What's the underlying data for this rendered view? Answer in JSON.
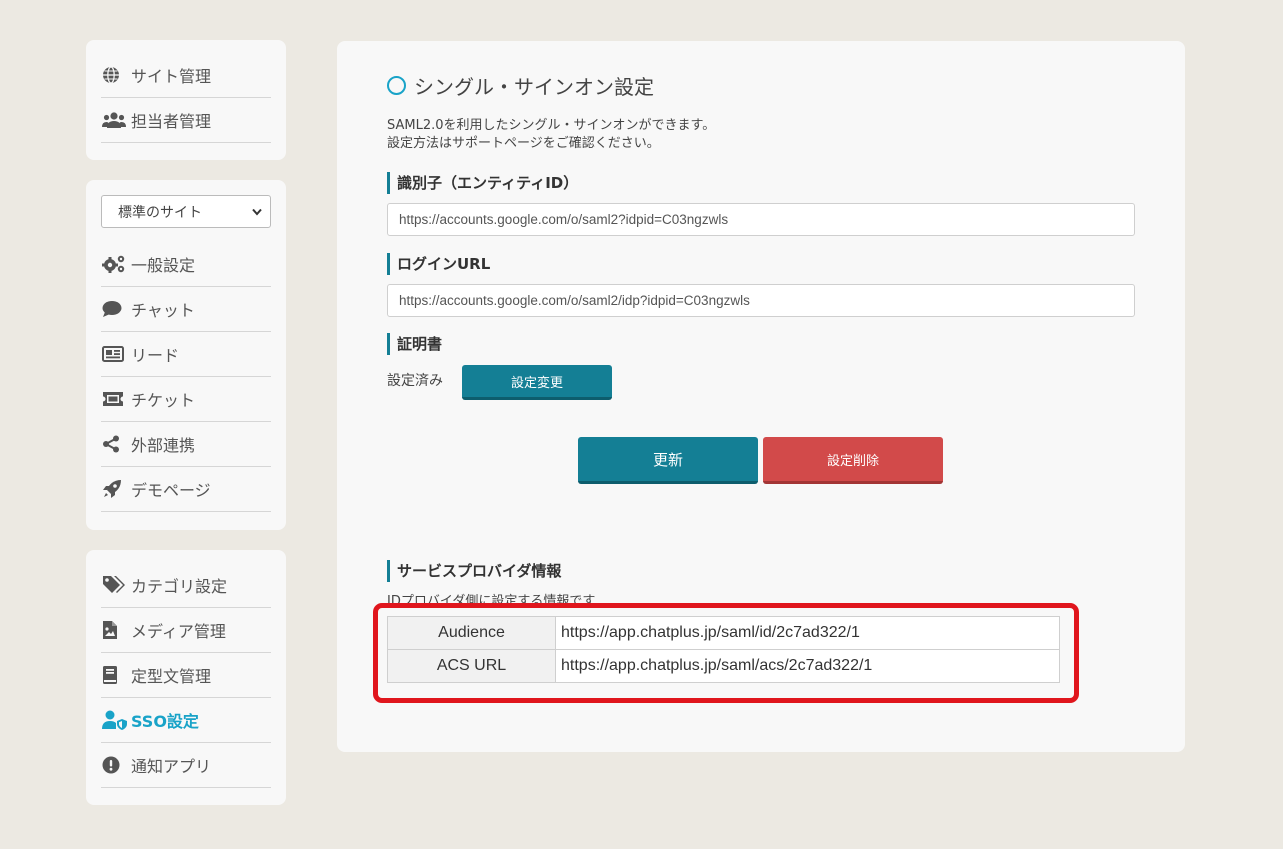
{
  "nav_top": [
    {
      "label": "サイト管理",
      "icon": "globe-icon"
    },
    {
      "label": "担当者管理",
      "icon": "users-icon"
    }
  ],
  "site_select": {
    "value": "標準のサイト"
  },
  "nav_mid": [
    {
      "label": "一般設定",
      "icon": "gears-icon"
    },
    {
      "label": "チャット",
      "icon": "comment-icon"
    },
    {
      "label": "リード",
      "icon": "newspaper-icon"
    },
    {
      "label": "チケット",
      "icon": "ticket-icon"
    },
    {
      "label": "外部連携",
      "icon": "share-icon"
    },
    {
      "label": "デモページ",
      "icon": "rocket-icon"
    }
  ],
  "nav_bottom": [
    {
      "label": "カテゴリ設定",
      "icon": "tags-icon"
    },
    {
      "label": "メディア管理",
      "icon": "image-file-icon"
    },
    {
      "label": "定型文管理",
      "icon": "book-icon"
    },
    {
      "label": "SSO設定",
      "icon": "user-shield-icon",
      "active": true
    },
    {
      "label": "通知アプリ",
      "icon": "exclamation-circle-icon"
    }
  ],
  "main": {
    "title": "シングル・サインオン設定",
    "desc_line1": "SAML2.0を利用したシングル・サインオンができます。",
    "desc_line2": "設定方法はサポートページをご確認ください。",
    "entity_id_label": "識別子（エンティティID）",
    "entity_id_value": "https://accounts.google.com/o/saml2?idpid=C03ngzwls",
    "login_url_label": "ログインURL",
    "login_url_value": "https://accounts.google.com/o/saml2/idp?idpid=C03ngzwls",
    "cert_label": "証明書",
    "cert_status": "設定済み",
    "cert_change_button": "設定変更",
    "update_button": "更新",
    "delete_button": "設定削除",
    "sp_label": "サービスプロバイダ情報",
    "sp_desc": "IDプロバイダ側に設定する情報です",
    "sp_rows": [
      {
        "key": "Audience",
        "value": "https://app.chatplus.jp/saml/id/2c7ad322/1"
      },
      {
        "key": "ACS URL",
        "value": "https://app.chatplus.jp/saml/acs/2c7ad322/1"
      }
    ]
  },
  "colors": {
    "accent": "#19a3c8",
    "primary_button": "#147f95",
    "danger_button": "#d24a4a",
    "highlight_box": "#e0161d"
  }
}
